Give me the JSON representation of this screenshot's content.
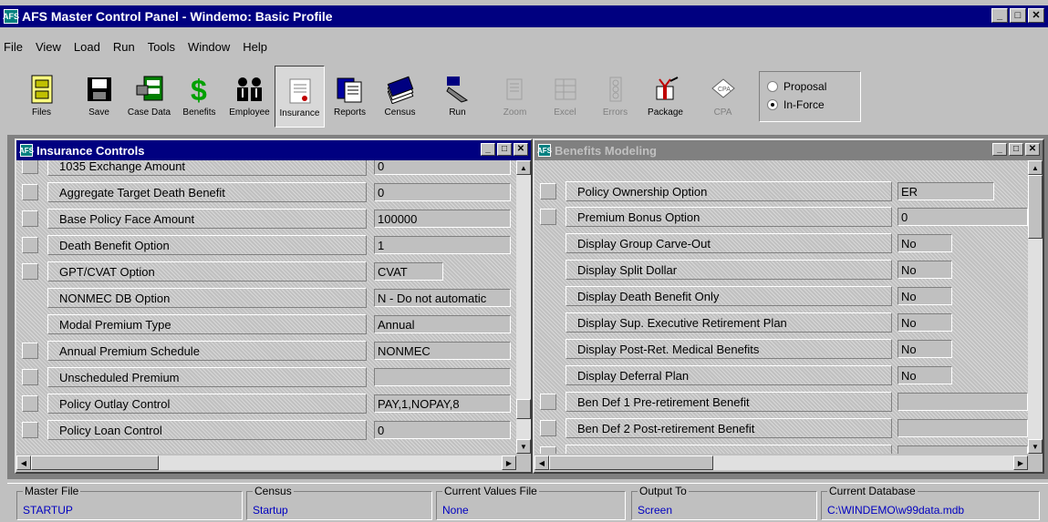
{
  "app": {
    "title": "AFS Master Control Panel - Windemo: Basic Profile",
    "icon_label": "AFS"
  },
  "window_buttons": {
    "minimize": "_",
    "maximize": "□",
    "close": "✕"
  },
  "menu": [
    "File",
    "View",
    "Load",
    "Run",
    "Tools",
    "Window",
    "Help"
  ],
  "toolbar": [
    {
      "label": "Files",
      "icon": "file-cabinet-icon"
    },
    {
      "label": "Save",
      "icon": "floppy-disk-icon"
    },
    {
      "label": "Case Data",
      "icon": "case-data-icon"
    },
    {
      "label": "Benefits",
      "icon": "dollar-icon"
    },
    {
      "label": "Employee",
      "icon": "people-icon"
    },
    {
      "label": "Insurance",
      "icon": "insurance-document-icon",
      "pressed": true
    },
    {
      "label": "Reports",
      "icon": "reports-icon"
    },
    {
      "label": "Census",
      "icon": "census-cards-icon"
    },
    {
      "label": "Run",
      "icon": "run-icon"
    },
    {
      "label": "Zoom",
      "icon": "zoom-icon",
      "disabled": true
    },
    {
      "label": "Excel",
      "icon": "excel-icon",
      "disabled": true
    },
    {
      "label": "Errors",
      "icon": "errors-icon",
      "disabled": true
    },
    {
      "label": "Package",
      "icon": "package-icon"
    },
    {
      "label": "CPA",
      "icon": "cpa-icon",
      "disabled": true
    }
  ],
  "mode": {
    "options": [
      "Proposal",
      "In-Force"
    ],
    "selected": "In-Force"
  },
  "insurance_controls": {
    "title": "Insurance Controls",
    "rows": [
      {
        "label": "1035 Exchange Amount",
        "value": "0",
        "check": true
      },
      {
        "label": "Aggregate Target Death Benefit",
        "value": "0",
        "check": true
      },
      {
        "label": "Base Policy Face Amount",
        "value": "100000",
        "check": true
      },
      {
        "label": "Death Benefit Option",
        "value": "1",
        "check": true
      },
      {
        "label": "GPT/CVAT Option",
        "value": "CVAT",
        "check": true
      },
      {
        "label": "NONMEC DB Option",
        "value": "N - Do not automatic",
        "check": false
      },
      {
        "label": "Modal Premium Type",
        "value": "Annual",
        "check": false
      },
      {
        "label": "Annual Premium Schedule",
        "value": "NONMEC",
        "check": true
      },
      {
        "label": "Unscheduled Premium",
        "value": "",
        "check": true
      },
      {
        "label": "Policy Outlay Control",
        "value": "PAY,1,NOPAY,8",
        "check": true
      },
      {
        "label": "Policy Loan Control",
        "value": "0",
        "check": true
      }
    ]
  },
  "benefits_modeling": {
    "title": "Benefits Modeling",
    "rows": [
      {
        "label": "Policy Ownership Option",
        "value": "ER",
        "check": true
      },
      {
        "label": "Premium Bonus Option",
        "value": "0",
        "check": true
      },
      {
        "label": "Display Group Carve-Out",
        "value": "No",
        "check": false
      },
      {
        "label": "Display Split Dollar",
        "value": "No",
        "check": false
      },
      {
        "label": "Display Death Benefit Only",
        "value": "No",
        "check": false
      },
      {
        "label": "Display Sup. Executive Retirement Plan",
        "value": "No",
        "check": false
      },
      {
        "label": "Display Post-Ret. Medical Benefits",
        "value": "No",
        "check": false
      },
      {
        "label": "Display Deferral Plan",
        "value": "No",
        "check": false
      },
      {
        "label": "Ben Def 1 Pre-retirement Benefit",
        "value": "",
        "check": true
      },
      {
        "label": "Ben Def 2 Post-retirement Benefit",
        "value": "",
        "check": true
      }
    ]
  },
  "status": [
    {
      "label": "Master File",
      "value": "STARTUP"
    },
    {
      "label": "Census",
      "value": "Startup"
    },
    {
      "label": "Current Values File",
      "value": "None"
    },
    {
      "label": "Output To",
      "value": "Screen"
    },
    {
      "label": "Current Database",
      "value": "C:\\WINDEMO\\w99data.mdb"
    }
  ],
  "colors": {
    "title_active": "#000080",
    "face": "#c0c0c0",
    "status_value": "#0000c0"
  }
}
